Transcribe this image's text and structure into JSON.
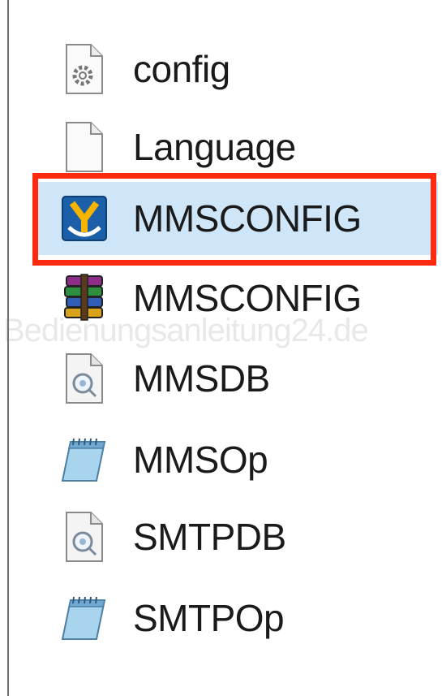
{
  "files": [
    {
      "name": "config",
      "icon": "settings-file-icon"
    },
    {
      "name": "Language",
      "icon": "blank-file-icon"
    },
    {
      "name": "MMSCONFIG",
      "icon": "app-executable-icon",
      "selected": true,
      "highlighted": true
    },
    {
      "name": "MMSCONFIG",
      "icon": "winrar-archive-icon"
    },
    {
      "name": "MMSDB",
      "icon": "database-file-icon"
    },
    {
      "name": "MMSOp",
      "icon": "notepad-text-icon"
    },
    {
      "name": "SMTPDB",
      "icon": "database-file-icon"
    },
    {
      "name": "SMTPOp",
      "icon": "notepad-text-icon"
    }
  ],
  "watermark": "Bedienungsanleitung24.de",
  "colors": {
    "highlight": "#ff2a10",
    "selection": "#cfe6f8",
    "app_icon": "#1a5fa8",
    "app_logo": "#f4b400"
  }
}
